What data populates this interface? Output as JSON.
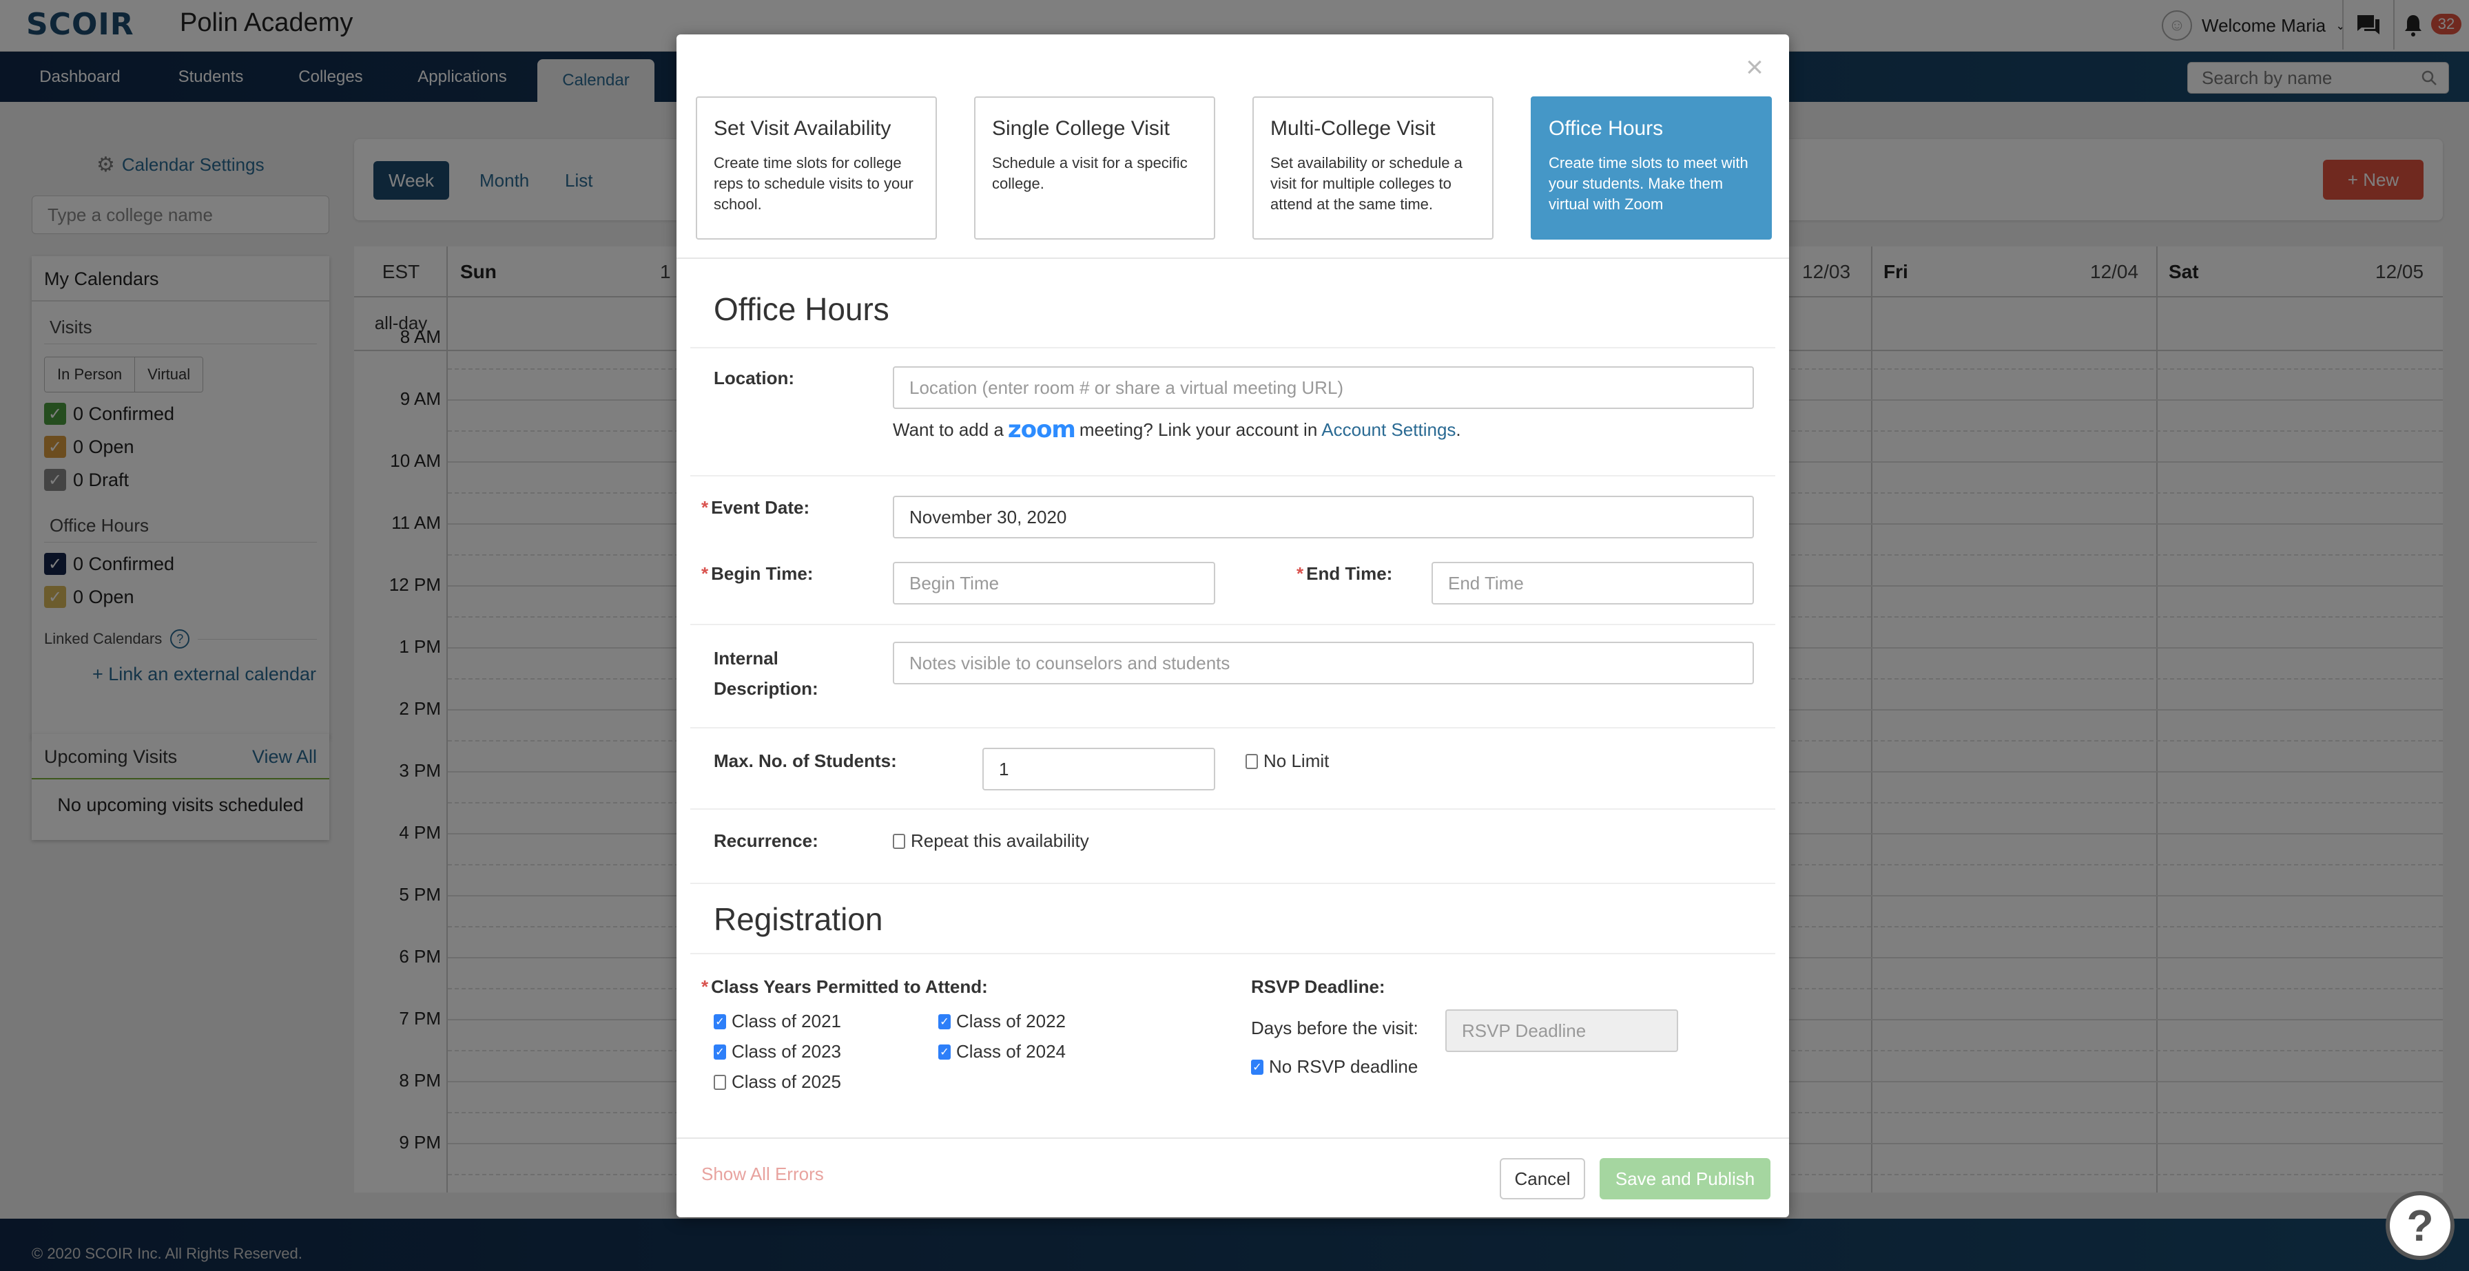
{
  "header": {
    "logo": "SCOIR",
    "school_name": "Polin Academy",
    "welcome": "Welcome Maria",
    "notification_count": "32"
  },
  "nav": {
    "items": [
      {
        "label": "Dashboard",
        "active": false
      },
      {
        "label": "Students",
        "active": false
      },
      {
        "label": "Colleges",
        "active": false
      },
      {
        "label": "Applications",
        "active": false
      },
      {
        "label": "Calendar",
        "active": true
      }
    ],
    "search_placeholder": "Search by name"
  },
  "sidebar": {
    "settings_label": "Calendar Settings",
    "college_input_placeholder": "Type a college name",
    "my_calendars": {
      "title": "My Calendars",
      "visits_title": "Visits",
      "visit_modes": [
        "In Person",
        "Virtual"
      ],
      "visits": [
        {
          "label": "0 Confirmed",
          "color": "#4a9a3e"
        },
        {
          "label": "0 Open",
          "color": "#d99a3e"
        },
        {
          "label": "0 Draft",
          "color": "#888888"
        }
      ],
      "office_hours_title": "Office Hours",
      "office_hours": [
        {
          "label": "0 Confirmed",
          "color": "#14254a"
        },
        {
          "label": "0 Open",
          "color": "#d9b85a"
        }
      ],
      "linked_calendars_label": "Linked Calendars",
      "link_external_label": "+ Link an external calendar"
    },
    "upcoming": {
      "title": "Upcoming Visits",
      "view_all": "View All",
      "empty": "No upcoming visits scheduled"
    }
  },
  "calendar": {
    "views": [
      "Week",
      "Month",
      "List"
    ],
    "active_view": "Week",
    "new_button": "+ New",
    "timezone": "EST",
    "allday_label": "all-day",
    "columns": [
      {
        "day": "Sun",
        "date": "1"
      },
      {
        "day": "Fri",
        "date": "12/04"
      },
      {
        "day": "Sat",
        "date": "12/05"
      }
    ],
    "partial_date": "12/03",
    "time_labels": [
      "8 AM",
      "9 AM",
      "10 AM",
      "11 AM",
      "12 PM",
      "1 PM",
      "2 PM",
      "3 PM",
      "4 PM",
      "5 PM",
      "6 PM",
      "7 PM",
      "8 PM",
      "9 PM"
    ]
  },
  "footer": {
    "copyright": "© 2020 SCOIR Inc. All Rights Reserved."
  },
  "modal": {
    "close_label": "×",
    "types": [
      {
        "title": "Set Visit Availability",
        "desc": "Create time slots for college reps to schedule visits to your school.",
        "active": false
      },
      {
        "title": "Single College Visit",
        "desc": "Schedule a visit for a specific college.",
        "active": false
      },
      {
        "title": "Multi-College Visit",
        "desc": "Set availability or schedule a visit for multiple colleges to attend at the same time.",
        "active": false
      },
      {
        "title": "Office Hours",
        "desc": "Create time slots to meet with your students. Make them virtual with Zoom",
        "active": true
      }
    ],
    "section_title": "Office Hours",
    "location": {
      "label": "Location:",
      "placeholder": "Location (enter room # or share a virtual meeting URL)",
      "hint_pre": "Want to add a",
      "hint_zoom": "zoom",
      "hint_mid": "meeting? Link your account in",
      "hint_link": "Account Settings",
      "hint_end": "."
    },
    "event_date": {
      "label": "Event Date:",
      "value": "November 30, 2020"
    },
    "begin_time": {
      "label": "Begin Time:",
      "placeholder": "Begin Time"
    },
    "end_time": {
      "label": "End Time:",
      "placeholder": "End Time"
    },
    "internal_desc": {
      "label_line1": "Internal",
      "label_line2": "Description:",
      "placeholder": "Notes visible to counselors and students"
    },
    "max_students": {
      "label": "Max. No. of Students:",
      "value": "1",
      "no_limit_label": "No Limit",
      "no_limit_checked": false
    },
    "recurrence": {
      "label": "Recurrence:",
      "checkbox_label": "Repeat this availability",
      "checked": false
    },
    "registration": {
      "title": "Registration",
      "class_years_label": "Class Years Permitted to Attend:",
      "class_years": [
        {
          "label": "Class of 2021",
          "checked": true
        },
        {
          "label": "Class of 2022",
          "checked": true
        },
        {
          "label": "Class of 2023",
          "checked": true
        },
        {
          "label": "Class of 2024",
          "checked": true
        },
        {
          "label": "Class of 2025",
          "checked": false
        }
      ],
      "rsvp_label": "RSVP Deadline:",
      "days_before_label": "Days before the visit:",
      "rsvp_placeholder": "RSVP Deadline",
      "no_rsvp_label": "No RSVP deadline",
      "no_rsvp_checked": true
    },
    "show_errors": "Show All Errors",
    "cancel": "Cancel",
    "save": "Save and Publish"
  }
}
